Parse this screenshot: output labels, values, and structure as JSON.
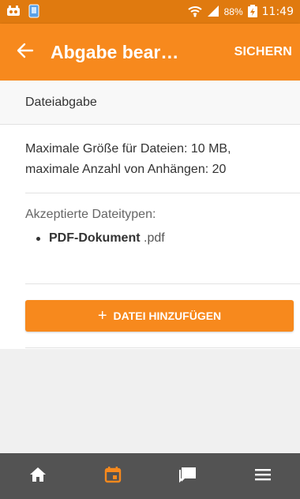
{
  "colors": {
    "accent": "#f7891d",
    "statusbar": "#e07a0f",
    "nav_background": "#535353",
    "nav_active": "#f7891d",
    "nav_inactive": "#ffffff"
  },
  "status_bar": {
    "battery_percent": "88%",
    "clock": "11:49"
  },
  "app_bar": {
    "title": "Abgabe bear…",
    "save_label": "SICHERN",
    "back_icon": "arrow-left-icon"
  },
  "section": {
    "header": "Dateiabgabe",
    "limits_line1": "Maximale Größe für Dateien: 10 MB,",
    "limits_line2": "maximale Anzahl von Anhängen: 20",
    "accepted_label": "Akzeptierte Dateitypen:",
    "file_types": [
      {
        "name": "PDF-Dokument",
        "ext": " .pdf"
      }
    ],
    "add_button_label": "DATEI HINZUFÜGEN"
  },
  "bottom_nav": {
    "items": [
      {
        "icon": "home-icon",
        "active": false
      },
      {
        "icon": "calendar-icon",
        "active": true
      },
      {
        "icon": "messages-icon",
        "active": false
      },
      {
        "icon": "menu-icon",
        "active": false
      }
    ]
  }
}
